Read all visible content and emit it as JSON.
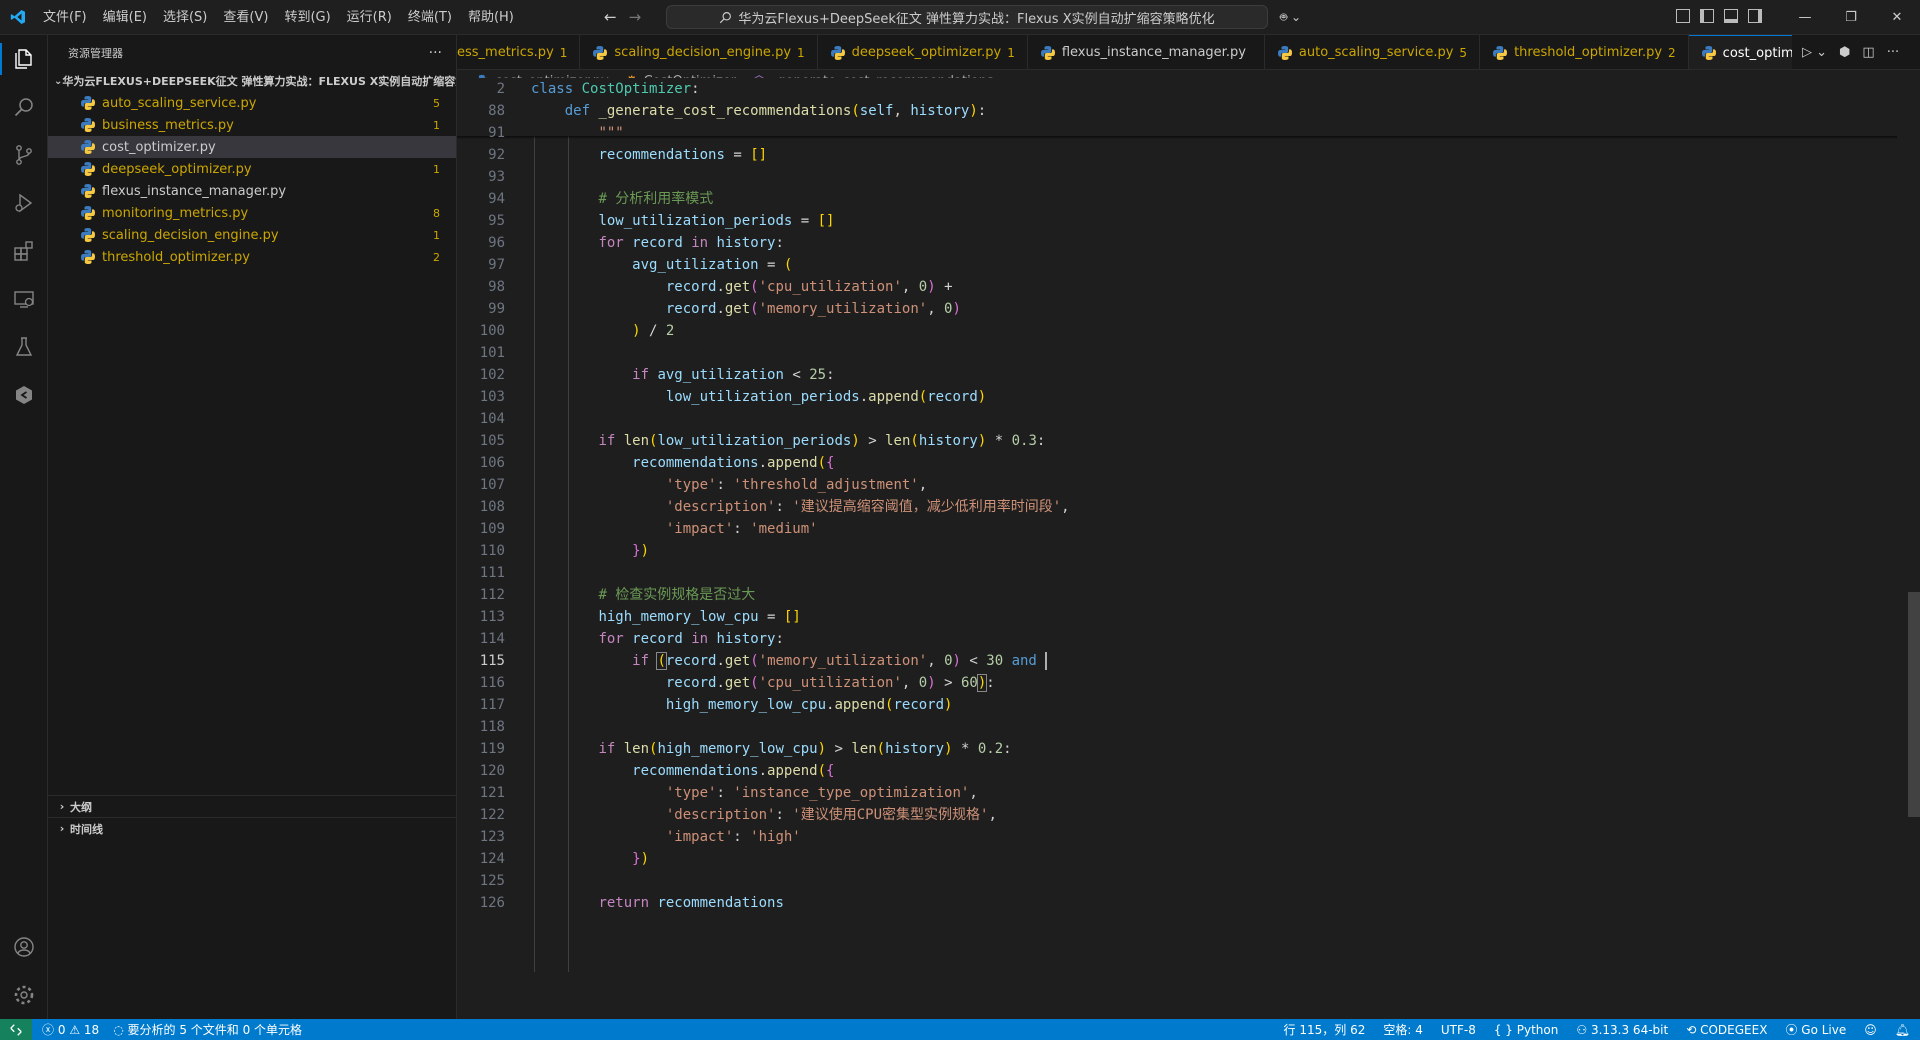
{
  "titlebar": {
    "menus": [
      "文件(F)",
      "编辑(E)",
      "选择(S)",
      "查看(V)",
      "转到(G)",
      "运行(R)",
      "终端(T)",
      "帮助(H)"
    ],
    "search_text": "华为云Flexus+DeepSeek征文 弹性算力实战：Flexus X实例自动扩缩容策略优化"
  },
  "sidebar": {
    "title": "资源管理器",
    "folder": "华为云FLEXUS+DEEPSEEK征文 弹性算力实战：FLEXUS X实例自动扩缩容策...",
    "files": [
      {
        "name": "auto_scaling_service.py",
        "badge": "5",
        "color": "#cca700"
      },
      {
        "name": "business_metrics.py",
        "badge": "1",
        "color": "#cca700"
      },
      {
        "name": "cost_optimizer.py",
        "badge": "",
        "color": "#cccccc"
      },
      {
        "name": "deepseek_optimizer.py",
        "badge": "1",
        "color": "#cca700"
      },
      {
        "name": "flexus_instance_manager.py",
        "badge": "",
        "color": "#cccccc"
      },
      {
        "name": "monitoring_metrics.py",
        "badge": "8",
        "color": "#cca700"
      },
      {
        "name": "scaling_decision_engine.py",
        "badge": "1",
        "color": "#cca700"
      },
      {
        "name": "threshold_optimizer.py",
        "badge": "2",
        "color": "#cca700"
      }
    ],
    "outline_label": "大纲",
    "timeline_label": "时间线"
  },
  "tabs": [
    {
      "name": "ess_metrics.py",
      "count": "1",
      "color": "#cca700",
      "icon": false
    },
    {
      "name": "scaling_decision_engine.py",
      "count": "1",
      "color": "#cca700",
      "icon": true
    },
    {
      "name": "deepseek_optimizer.py",
      "count": "1",
      "color": "#cca700",
      "icon": true
    },
    {
      "name": "flexus_instance_manager.py",
      "count": "",
      "color": "#cccccc",
      "icon": true
    },
    {
      "name": "auto_scaling_service.py",
      "count": "5",
      "color": "#cca700",
      "icon": true
    },
    {
      "name": "threshold_optimizer.py",
      "count": "2",
      "color": "#cca700",
      "icon": true
    },
    {
      "name": "cost_optimizer.py",
      "count": "",
      "color": "#ffffff",
      "icon": true,
      "active": true
    }
  ],
  "breadcrumb": {
    "file": "cost_optimizer.py",
    "cls": "CostOptimizer",
    "method": "_generate_cost_recommendations"
  },
  "sticky": [
    {
      "n": "2",
      "code": "<span class='k'>class</span> <span class='cls'>CostOptimizer</span><span class='p'>:</span>"
    },
    {
      "n": "88",
      "code": "    <span class='k'>def</span> <span class='fn'>_generate_cost_recommendations</span><span class='b1'>(</span><span class='v'>self</span><span class='p'>, </span><span class='v'>history</span><span class='b1'>)</span><span class='p'>:</span>"
    }
  ],
  "code": [
    {
      "n": "91",
      "code": "        <span class='s'>\"\"\"</span>"
    },
    {
      "n": "92",
      "code": "        <span class='v'>recommendations</span> <span class='p'>=</span> <span class='b1'>[]</span>"
    },
    {
      "n": "93",
      "code": ""
    },
    {
      "n": "94",
      "code": "        <span class='c'># 分析利用率模式</span>"
    },
    {
      "n": "95",
      "code": "        <span class='v'>low_utilization_periods</span> <span class='p'>=</span> <span class='b1'>[]</span>"
    },
    {
      "n": "96",
      "code": "        <span class='kc'>for</span> <span class='v'>record</span> <span class='kc'>in</span> <span class='v'>history</span><span class='p'>:</span>"
    },
    {
      "n": "97",
      "code": "            <span class='v'>avg_utilization</span> <span class='p'>=</span> <span class='b1'>(</span>"
    },
    {
      "n": "98",
      "code": "                <span class='v'>record</span><span class='p'>.</span><span class='fn'>get</span><span class='b2'>(</span><span class='s'>'cpu_utilization'</span><span class='p'>, </span><span class='n'>0</span><span class='b2'>)</span> <span class='p'>+</span>"
    },
    {
      "n": "99",
      "code": "                <span class='v'>record</span><span class='p'>.</span><span class='fn'>get</span><span class='b2'>(</span><span class='s'>'memory_utilization'</span><span class='p'>, </span><span class='n'>0</span><span class='b2'>)</span>"
    },
    {
      "n": "100",
      "code": "            <span class='b1'>)</span> <span class='p'>/</span> <span class='n'>2</span>"
    },
    {
      "n": "101",
      "code": ""
    },
    {
      "n": "102",
      "code": "            <span class='kc'>if</span> <span class='v'>avg_utilization</span> <span class='p'>&lt;</span> <span class='n'>25</span><span class='p'>:</span>"
    },
    {
      "n": "103",
      "code": "                <span class='v'>low_utilization_periods</span><span class='p'>.</span><span class='fn'>append</span><span class='b1'>(</span><span class='v'>record</span><span class='b1'>)</span>"
    },
    {
      "n": "104",
      "code": ""
    },
    {
      "n": "105",
      "code": "        <span class='kc'>if</span> <span class='fn'>len</span><span class='b1'>(</span><span class='v'>low_utilization_periods</span><span class='b1'>)</span> <span class='p'>&gt;</span> <span class='fn'>len</span><span class='b1'>(</span><span class='v'>history</span><span class='b1'>)</span> <span class='p'>*</span> <span class='n'>0.3</span><span class='p'>:</span>"
    },
    {
      "n": "106",
      "code": "            <span class='v'>recommendations</span><span class='p'>.</span><span class='fn'>append</span><span class='b1'>(</span><span class='b2'>{</span>"
    },
    {
      "n": "107",
      "code": "                <span class='s'>'type'</span><span class='p'>: </span><span class='s'>'threshold_adjustment'</span><span class='p'>,</span>"
    },
    {
      "n": "108",
      "code": "                <span class='s'>'description'</span><span class='p'>: </span><span class='s'>'建议提高缩容阈值，减少低利用率时间段'</span><span class='p'>,</span>"
    },
    {
      "n": "109",
      "code": "                <span class='s'>'impact'</span><span class='p'>: </span><span class='s'>'medium'</span>"
    },
    {
      "n": "110",
      "code": "            <span class='b2'>}</span><span class='b1'>)</span>"
    },
    {
      "n": "111",
      "code": ""
    },
    {
      "n": "112",
      "code": "        <span class='c'># 检查实例规格是否过大</span>"
    },
    {
      "n": "113",
      "code": "        <span class='v'>high_memory_low_cpu</span> <span class='p'>=</span> <span class='b1'>[]</span>"
    },
    {
      "n": "114",
      "code": "        <span class='kc'>for</span> <span class='v'>record</span> <span class='kc'>in</span> <span class='v'>history</span><span class='p'>:</span>"
    },
    {
      "n": "115",
      "current": true,
      "code": "            <span class='kc'>if</span> <span class='b1 bm'>(</span><span class='v'>record</span><span class='p'>.</span><span class='fn'>get</span><span class='b2'>(</span><span class='s'>'memory_utilization'</span><span class='p'>, </span><span class='n'>0</span><span class='b2'>)</span> <span class='p'>&lt;</span> <span class='n'>30</span> <span class='k'>and</span> <span class='cursor'></span>"
    },
    {
      "n": "116",
      "code": "                <span class='v'>record</span><span class='p'>.</span><span class='fn'>get</span><span class='b2'>(</span><span class='s'>'cpu_utilization'</span><span class='p'>, </span><span class='n'>0</span><span class='b2'>)</span> <span class='p'>&gt;</span> <span class='n'>60</span><span class='b1 bm'>)</span><span class='p'>:</span>"
    },
    {
      "n": "117",
      "code": "                <span class='v'>high_memory_low_cpu</span><span class='p'>.</span><span class='fn'>append</span><span class='b1'>(</span><span class='v'>record</span><span class='b1'>)</span>"
    },
    {
      "n": "118",
      "code": ""
    },
    {
      "n": "119",
      "code": "        <span class='kc'>if</span> <span class='fn'>len</span><span class='b1'>(</span><span class='v'>high_memory_low_cpu</span><span class='b1'>)</span> <span class='p'>&gt;</span> <span class='fn'>len</span><span class='b1'>(</span><span class='v'>history</span><span class='b1'>)</span> <span class='p'>*</span> <span class='n'>0.2</span><span class='p'>:</span>"
    },
    {
      "n": "120",
      "code": "            <span class='v'>recommendations</span><span class='p'>.</span><span class='fn'>append</span><span class='b1'>(</span><span class='b2'>{</span>"
    },
    {
      "n": "121",
      "code": "                <span class='s'>'type'</span><span class='p'>: </span><span class='s'>'instance_type_optimization'</span><span class='p'>,</span>"
    },
    {
      "n": "122",
      "code": "                <span class='s'>'description'</span><span class='p'>: </span><span class='s'>'建议使用CPU密集型实例规格'</span><span class='p'>,</span>"
    },
    {
      "n": "123",
      "code": "                <span class='s'>'impact'</span><span class='p'>: </span><span class='s'>'high'</span>"
    },
    {
      "n": "124",
      "code": "            <span class='b2'>}</span><span class='b1'>)</span>"
    },
    {
      "n": "125",
      "code": ""
    },
    {
      "n": "126",
      "code": "        <span class='kc'>return</span> <span class='v'>recommendations</span>"
    }
  ],
  "status": {
    "errors": "0",
    "warnings": "18",
    "message": "要分析的 5 个文件和 0 个单元格",
    "position": "行 115，列 62",
    "spaces": "空格: 4",
    "encoding": "UTF-8",
    "language": "Python",
    "interpreter": "3.13.3 64-bit",
    "codegeex": "CODEGEEX",
    "golive": "Go Live"
  },
  "colors": {
    "accent": "#0078d4",
    "statusbar": "#007acc",
    "warning": "#cca700"
  }
}
